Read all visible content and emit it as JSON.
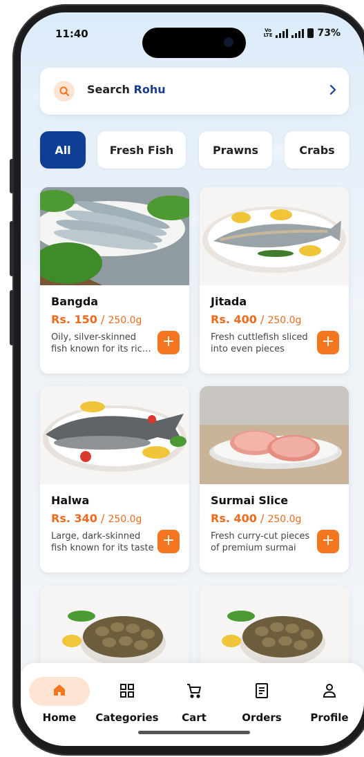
{
  "status_bar": {
    "time": "11:40",
    "network_top": "Vo",
    "network_bottom": "LTE",
    "battery": "73%"
  },
  "search": {
    "prefix": "Search",
    "keyword": "Rohu"
  },
  "categories": [
    {
      "label": "All",
      "active": true
    },
    {
      "label": "Fresh Fish",
      "active": false
    },
    {
      "label": "Prawns",
      "active": false
    },
    {
      "label": "Crabs",
      "active": false
    }
  ],
  "products": [
    {
      "name": "Bangda",
      "price": "Rs. 150",
      "unit": "250.0g",
      "desc": "Oily, silver-skinned fish known for its rich flavour"
    },
    {
      "name": "Jitada",
      "price": "Rs. 400",
      "unit": "250.0g",
      "desc": "Fresh cuttlefish sliced into even pieces"
    },
    {
      "name": "Halwa",
      "price": "Rs. 340",
      "unit": "250.0g",
      "desc": "Large, dark-skinned fish known for its taste"
    },
    {
      "name": "Surmai Slice",
      "price": "Rs. 400",
      "unit": "250.0g",
      "desc": "Fresh curry-cut pieces of premium surmai"
    }
  ],
  "price_separator": "/",
  "nav": [
    {
      "label": "Home",
      "icon": "home-icon",
      "active": true
    },
    {
      "label": "Categories",
      "icon": "grid-icon",
      "active": false
    },
    {
      "label": "Cart",
      "icon": "cart-icon",
      "active": false
    },
    {
      "label": "Orders",
      "icon": "orders-icon",
      "active": false
    },
    {
      "label": "Profile",
      "icon": "profile-icon",
      "active": false
    }
  ],
  "colors": {
    "accent": "#f47621",
    "primary": "#0e3f95",
    "price": "#f06a1d"
  }
}
